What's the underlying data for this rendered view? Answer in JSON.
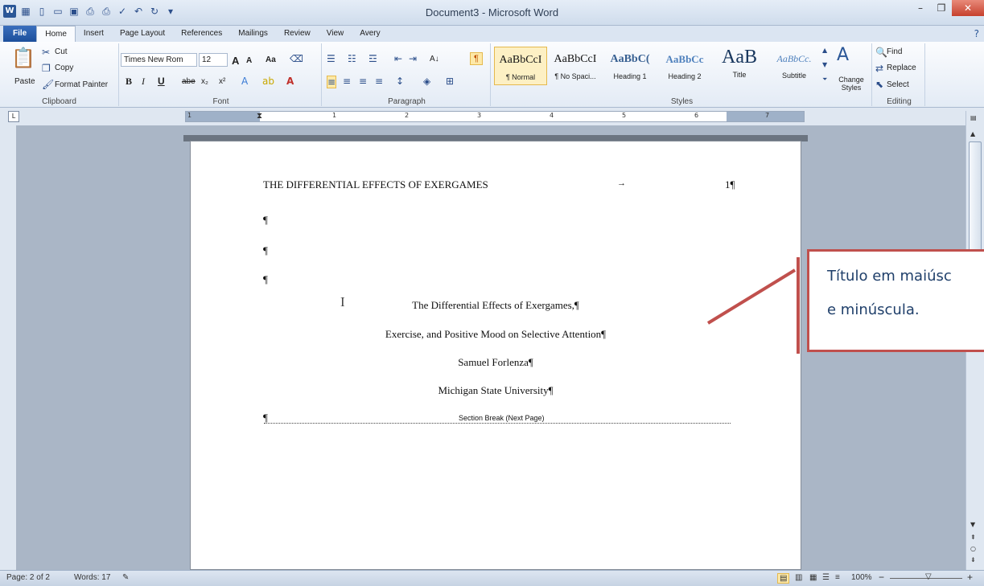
{
  "window": {
    "title": "Document3 - Microsoft Word",
    "min": "–",
    "max": "❐",
    "close": "✕"
  },
  "qat": {
    "logo": "W"
  },
  "tabs": [
    "File",
    "Home",
    "Insert",
    "Page Layout",
    "References",
    "Mailings",
    "Review",
    "View",
    "Avery"
  ],
  "help_icon": "?",
  "clipboard": {
    "paste": "Paste",
    "cut": "Cut",
    "copy": "Copy",
    "format_painter": "Format Painter",
    "label": "Clipboard"
  },
  "font": {
    "family": "Times New Rom",
    "size": "12",
    "bold": "B",
    "italic": "I",
    "underline": "U",
    "strike": "abe",
    "sub": "x₂",
    "sup": "x²",
    "clear": "Aa",
    "grow": "A",
    "shrink": "A",
    "label": "Font"
  },
  "paragraph": {
    "label": "Paragraph",
    "pilcrow": "¶",
    "sort": "A↓"
  },
  "styles": {
    "label": "Styles",
    "items": [
      {
        "sample": "AaBbCcI",
        "name": "¶ Normal"
      },
      {
        "sample": "AaBbCcI",
        "name": "¶ No Spaci..."
      },
      {
        "sample": "AaBbC(",
        "name": "Heading 1"
      },
      {
        "sample": "AaBbCc",
        "name": "Heading 2"
      },
      {
        "sample": "AaB",
        "name": "Title"
      },
      {
        "sample": "AaBbCc.",
        "name": "Subtitle"
      }
    ],
    "change_styles": "Change Styles"
  },
  "editing": {
    "find": "Find",
    "replace": "Replace",
    "select": "Select",
    "label": "Editing"
  },
  "ruler": {
    "numbers": [
      "1",
      "1",
      "2",
      "3",
      "4",
      "5",
      "6",
      "7"
    ],
    "tab_btn": "L"
  },
  "document": {
    "header": "THE DIFFERENTIAL EFFECTS OF EXERGAMES",
    "header_tab": "→",
    "page_num": "1¶",
    "pilcrow": "¶",
    "title_line1": "The Differential Effects of Exergames,¶",
    "title_line2": "Exercise, and Positive Mood on Selective Attention¶",
    "author": "Samuel Forlenza¶",
    "institution": "Michigan State University¶",
    "section_break": "Section Break (Next Page)",
    "cursor": "I"
  },
  "callout": {
    "line1": "Título em maiúsc",
    "line2": "e minúscula."
  },
  "status": {
    "page": "Page: 2 of 2",
    "words": "Words: 17",
    "zoom": "100%",
    "zoom_out": "−",
    "zoom_in": "+"
  }
}
